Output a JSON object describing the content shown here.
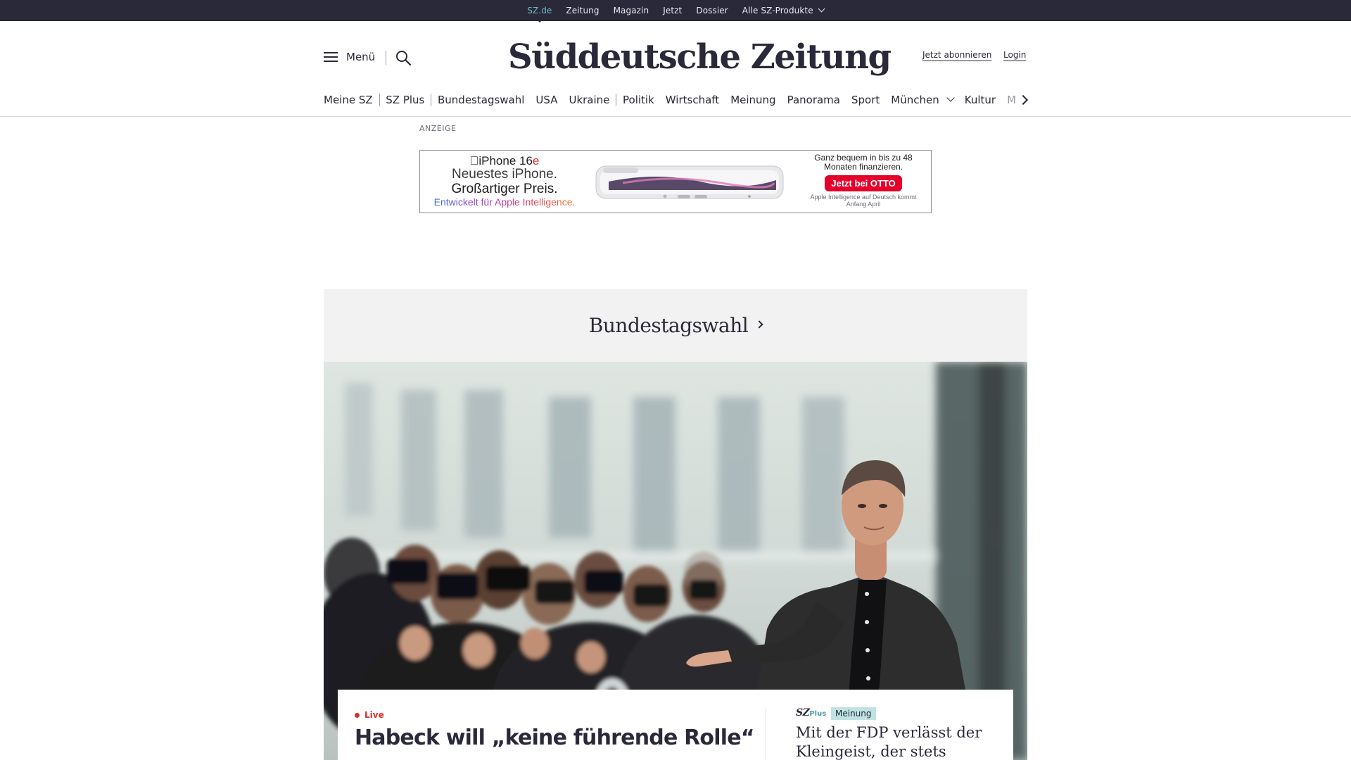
{
  "topbar": {
    "links": [
      {
        "label": "SZ.de",
        "active": true
      },
      {
        "label": "Zeitung"
      },
      {
        "label": "Magazin"
      },
      {
        "label": "Jetzt"
      },
      {
        "label": "Dossier"
      },
      {
        "label": "Alle SZ-Produkte",
        "dropdown": true
      }
    ]
  },
  "header": {
    "menu_label": "Menü",
    "logo_text": "Süddeutsche Zeitung",
    "subscribe_label": "Jetzt abonnieren",
    "login_label": "Login"
  },
  "nav": {
    "items": [
      "Meine SZ",
      "SZ Plus",
      "Bundestagswahl",
      "USA",
      "Ukraine",
      "Politik",
      "Wirtschaft",
      "Meinung",
      "Panorama",
      "Sport",
      "München",
      "Kultur",
      "M"
    ]
  },
  "ad": {
    "label": "ANZEIGE",
    "product": "iPhone 16",
    "product_suffix": "e",
    "line2": "Neuestes iPhone.",
    "line3": "Großartiger Preis.",
    "line4": "Entwickelt für Apple Intelligence.",
    "right_line1": "Ganz bequem in bis zu 48 Monaten finanzieren.",
    "cta": "Jetzt bei OTTO",
    "right_line2": "Apple Intelligence auf Deutsch kommt Anfang April"
  },
  "section": {
    "title": "Bundestagswahl"
  },
  "lead": {
    "live_label": "Live",
    "headline": "Habeck will „keine führende Rolle“"
  },
  "side": {
    "brand": "SZ",
    "brand_plus": "Plus",
    "badge": "Meinung",
    "headline": "Mit der FDP verlässt der Kleingeist, der stets"
  },
  "colors": {
    "topbar_bg": "#29293a",
    "accent_teal": "#71b7c7",
    "live_red": "#d4302b",
    "opinion_badge": "#bfe3e2",
    "section_bg": "#f2f2f2"
  }
}
